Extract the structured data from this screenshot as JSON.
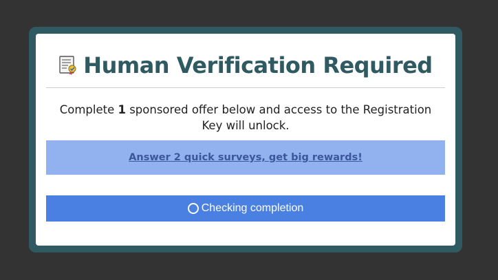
{
  "modal": {
    "title": "Human Verification Required",
    "title_icon": "certificate-document-icon",
    "instructions": {
      "prefix": "Complete ",
      "count": "1",
      "suffix": " sponsored offer below and access to the Registration Key will unlock."
    },
    "offer_link": "Answer 2 quick surveys, get big rewards!",
    "status": {
      "icon": "loading-spinner-icon",
      "text": "Checking completion"
    }
  },
  "colors": {
    "background": "#333333",
    "frame": "#2f5a62",
    "title": "#2f5a62",
    "offer_box": "#91b2ee",
    "offer_link": "#3a579a",
    "status_bar": "#4a80e2"
  }
}
